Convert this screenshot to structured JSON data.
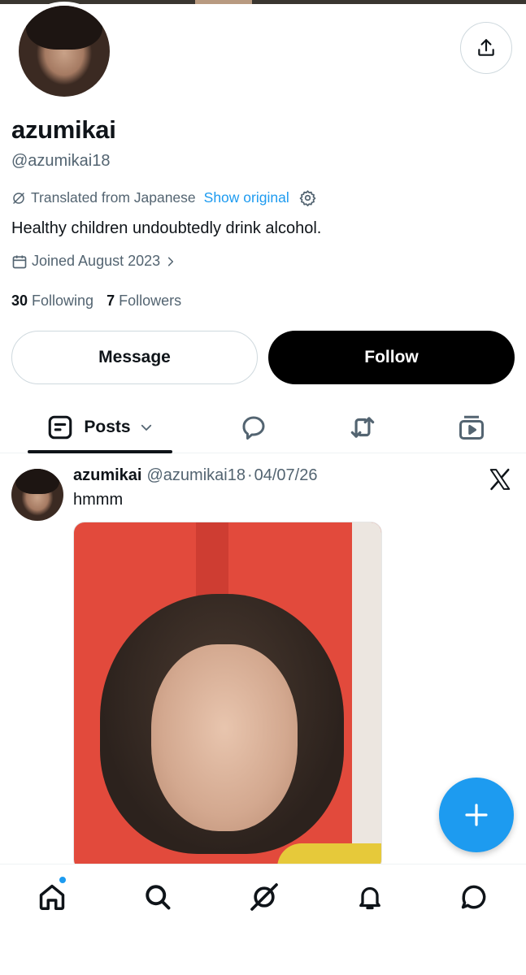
{
  "profile": {
    "display_name": "azumikai",
    "handle": "@azumikai18",
    "translated_label": "Translated from Japanese",
    "show_original_label": "Show original",
    "bio": "Healthy children undoubtedly drink alcohol.",
    "joined": "Joined August 2023",
    "following_count": "30",
    "following_label": "Following",
    "followers_count": "7",
    "followers_label": "Followers"
  },
  "actions": {
    "message_label": "Message",
    "follow_label": "Follow"
  },
  "tabs": {
    "posts_label": "Posts",
    "icons": [
      "posts-icon",
      "replies-icon",
      "reposts-icon",
      "media-icon"
    ]
  },
  "post": {
    "author_name": "azumikai",
    "author_handle": "@azumikai18",
    "separator": "·",
    "date": "04/07/26",
    "text": "hmmm"
  },
  "bottom_nav": {
    "items": [
      "home-icon",
      "search-icon",
      "grok-icon",
      "notifications-icon",
      "messages-icon"
    ],
    "notification_dot": true
  },
  "colors": {
    "accent": "#1d9bf0",
    "text_primary": "#0f1419",
    "text_secondary": "#536471",
    "follow_button_bg": "#000000"
  }
}
